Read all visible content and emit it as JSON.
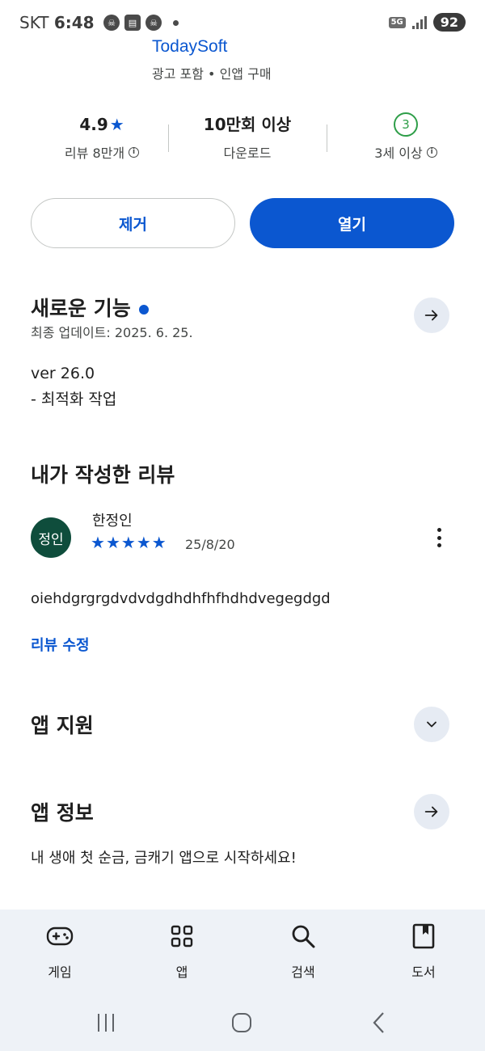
{
  "status_bar": {
    "carrier": "SKT",
    "time": "6:48",
    "network": "5G",
    "battery": "92"
  },
  "app": {
    "name": "TodaySoft",
    "meta": "광고 포함 • 인앱 구매"
  },
  "stats": {
    "rating": "4.9",
    "reviews_label": "리뷰 8만개",
    "downloads": "10만회 이상",
    "downloads_label": "다운로드",
    "age_badge": "3",
    "age_label": "3세 이상"
  },
  "buttons": {
    "remove": "제거",
    "open": "열기"
  },
  "whats_new": {
    "title": "새로운 기능",
    "updated": "최종 업데이트: 2025. 6. 25.",
    "version": "ver 26.0",
    "notes": "- 최적화 작업"
  },
  "my_review": {
    "title": "내가 작성한 리뷰",
    "avatar_text": "정인",
    "reviewer": "한정인",
    "stars": 5,
    "date": "25/8/20",
    "body": "oiehdgrgrgdvdvdgdhdhfhfhdhdvegegdgd",
    "edit_label": "리뷰 수정"
  },
  "app_support": {
    "title": "앱 지원"
  },
  "app_info": {
    "title": "앱 정보",
    "description": "내 생애 첫 순금, 금캐기 앱으로 시작하세요!"
  },
  "bottom_nav": {
    "items": [
      {
        "label": "게임",
        "icon": "gamepad-icon"
      },
      {
        "label": "앱",
        "icon": "apps-grid-icon"
      },
      {
        "label": "검색",
        "icon": "search-icon"
      },
      {
        "label": "도서",
        "icon": "book-icon"
      }
    ]
  },
  "colors": {
    "accent": "#0b57d0",
    "age_badge": "#2e9e48",
    "avatar_bg": "#0f4d3c",
    "nav_bg": "#eef2f7"
  }
}
